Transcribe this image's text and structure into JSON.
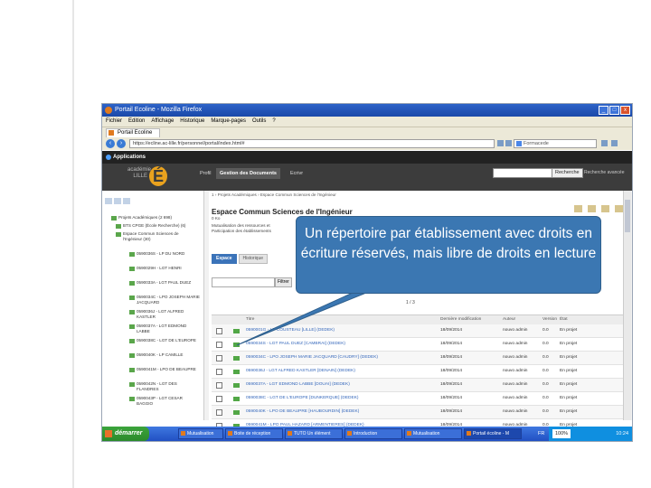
{
  "window": {
    "title": "Portail Ecoline - Mozilla Firefox",
    "controls": [
      "_",
      "□",
      "x"
    ]
  },
  "menu": [
    "Fichier",
    "Edition",
    "Affichage",
    "Historique",
    "Marque-pages",
    "Outils",
    "?"
  ],
  "browser_tab": "Portail Ecoline",
  "url": "https://ecline.ac-lille.fr/personnel/portal/index.html#",
  "search_engine": "Formacede",
  "portal": {
    "apps_label": "Applications"
  },
  "header": {
    "logo_text": "académie LILLE",
    "logo_letter": "É",
    "nav": [
      "Profil",
      "Gestion des Documents",
      "Ecrivr"
    ],
    "search_button": "Recherche",
    "advanced_search": "Recherche avancée"
  },
  "sidebar": {
    "items": [
      "Projets Académiques (2 698)",
      "BTS CPGE (École Recherche) (6)",
      "Espace Commun Sciences de l'Ingénieur (30)",
      "0590036S - LP DU NORD",
      "0590029H - LGT HENRI",
      "0590033A - LGT PAUL DUEZ",
      "0590034C - LPO JOSEPH MARIE JACQUARD",
      "0590036J - LGT ALFRED KASTLER",
      "0590037A - LGT EDMOND LABBE",
      "0590038C - LGT DE L'EUROPE",
      "0590040K - LP CAMILLE",
      "0590041M - LPO DE BEAUPRE",
      "0590042N - LGT DES FLANDRES",
      "0590043P - LGT CESAR BAGGIO"
    ]
  },
  "main": {
    "breadcrumb": "1 › Projets Académiques › Espace Commun Sciences de l'Ingénieur",
    "title": "Espace Commun Sciences de l'Ingénieur",
    "size": "0 Ko",
    "description": "Mutualisation des ressources et Participation des établissements",
    "tabs": [
      "Espace",
      "Historique"
    ],
    "filter_button": "Filtrer",
    "pager": "1 / 3",
    "columns": [
      "Titre",
      "Dernière modification",
      "Auteur",
      "Version",
      "État"
    ],
    "rows": [
      {
        "name": "0590001G - LP COUSTEAU [LILLE] (DEDEK)",
        "date": "18/09/2014",
        "owner": "nouvo admin",
        "version": "0.0",
        "status": "En projet"
      },
      {
        "name": "0590034S - LGT PAUL DUEZ [CAMBRAI] (DEDEK)",
        "date": "18/09/2014",
        "owner": "nouvo admin",
        "version": "0.0",
        "status": "En projet"
      },
      {
        "name": "0590034C - LPO JOSEPH MARIE JACQUARD [CAUDRY] (DEDEK)",
        "date": "18/09/2014",
        "owner": "nouvo admin",
        "version": "0.0",
        "status": "En projet"
      },
      {
        "name": "0590036J - LGT ALFRED KASTLER [DENAIN] (DEDEK)",
        "date": "18/09/2014",
        "owner": "nouvo admin",
        "version": "0.0",
        "status": "En projet"
      },
      {
        "name": "0590037A - LGT EDMOND LABBE [DOUAI] (DEDEK)",
        "date": "18/09/2014",
        "owner": "nouvo admin",
        "version": "0.0",
        "status": "En projet"
      },
      {
        "name": "0590038C - LGT DE L'EUROPE [DUNKERQUE] (DEDEK)",
        "date": "18/09/2014",
        "owner": "nouvo admin",
        "version": "0.0",
        "status": "En projet"
      },
      {
        "name": "0590040K - LPO DE BEAUPRE [HAUBOURDIN] (DEDEK)",
        "date": "18/09/2014",
        "owner": "nouvo admin",
        "version": "0.0",
        "status": "En projet"
      },
      {
        "name": "0590041M - LPO PAUL HAZARD [ARMENTIERES] (DEDEK)",
        "date": "18/09/2014",
        "owner": "nouvo admin",
        "version": "0.0",
        "status": "En projet"
      }
    ]
  },
  "taskbar": {
    "start": "démarrer",
    "tasks": [
      "Mutualisation",
      "Boite de réception",
      "TUTO Un élément",
      "Introduction",
      "Mutualisation",
      "Portail écoline - M"
    ],
    "language": "FR",
    "zoom": "100%",
    "clock": "10:24"
  },
  "callout": {
    "text": "Un répertoire par établissement avec droits en écriture réservés, mais libre de droits en lecture"
  },
  "colors": {
    "callout_bg": "#3b77b2",
    "folder_green": "#52a746",
    "link_blue": "#3366bb"
  }
}
